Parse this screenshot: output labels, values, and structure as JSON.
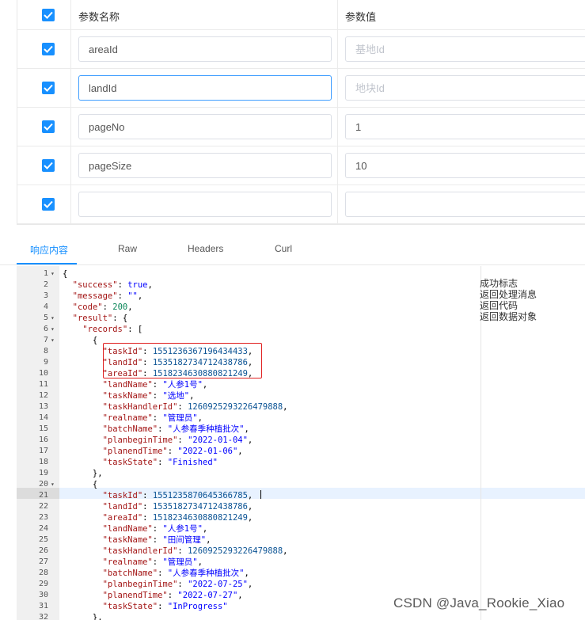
{
  "params": {
    "header": {
      "name": "参数名称",
      "value": "参数值"
    },
    "rows": [
      {
        "checked": true,
        "name": "areaId",
        "value": "",
        "placeholder": "基地Id"
      },
      {
        "checked": true,
        "name": "landId",
        "value": "",
        "placeholder": "地块Id"
      },
      {
        "checked": true,
        "name": "pageNo",
        "value": "1",
        "placeholder": ""
      },
      {
        "checked": true,
        "name": "pageSize",
        "value": "10",
        "placeholder": ""
      },
      {
        "checked": true,
        "name": "",
        "value": "",
        "placeholder": ""
      }
    ]
  },
  "tabs": [
    "响应内容",
    "Raw",
    "Headers",
    "Curl"
  ],
  "active_tab": "响应内容",
  "comments": [
    "成功标志",
    "返回处理消息",
    "返回代码",
    "返回数据对象"
  ],
  "code_lines": [
    {
      "n": "1",
      "fold": true,
      "code": "{"
    },
    {
      "n": "2",
      "code": "  \"success\": true,"
    },
    {
      "n": "3",
      "code": "  \"message\": \"\","
    },
    {
      "n": "4",
      "code": "  \"code\": 200,"
    },
    {
      "n": "5",
      "fold": true,
      "code": "  \"result\": {"
    },
    {
      "n": "6",
      "fold": true,
      "code": "    \"records\": ["
    },
    {
      "n": "7",
      "fold": true,
      "code": "      {"
    },
    {
      "n": "8",
      "code": "        \"taskId\": 1551236367196434433,"
    },
    {
      "n": "9",
      "code": "        \"landId\": 1535182734712438786,"
    },
    {
      "n": "10",
      "code": "        \"areaId\": 1518234630880821249,"
    },
    {
      "n": "11",
      "code": "        \"landName\": \"人参1号\","
    },
    {
      "n": "12",
      "code": "        \"taskName\": \"选地\","
    },
    {
      "n": "13",
      "code": "        \"taskHandlerId\": 1260925293226479888,"
    },
    {
      "n": "14",
      "code": "        \"realname\": \"管理员\","
    },
    {
      "n": "15",
      "code": "        \"batchName\": \"人参春季种植批次\","
    },
    {
      "n": "16",
      "code": "        \"planbeginTime\": \"2022-01-04\","
    },
    {
      "n": "17",
      "code": "        \"planendTime\": \"2022-01-06\","
    },
    {
      "n": "18",
      "code": "        \"taskState\": \"Finished\""
    },
    {
      "n": "19",
      "code": "      },"
    },
    {
      "n": "20",
      "fold": true,
      "code": "      {"
    },
    {
      "n": "21",
      "code": "        \"taskId\": 1551235870645366785,"
    },
    {
      "n": "22",
      "code": "        \"landId\": 1535182734712438786,"
    },
    {
      "n": "23",
      "code": "        \"areaId\": 1518234630880821249,"
    },
    {
      "n": "24",
      "code": "        \"landName\": \"人参1号\","
    },
    {
      "n": "25",
      "code": "        \"taskName\": \"田间管理\","
    },
    {
      "n": "26",
      "code": "        \"taskHandlerId\": 1260925293226479888,"
    },
    {
      "n": "27",
      "code": "        \"realname\": \"管理员\","
    },
    {
      "n": "28",
      "code": "        \"batchName\": \"人参春季种植批次\","
    },
    {
      "n": "29",
      "code": "        \"planbeginTime\": \"2022-07-25\","
    },
    {
      "n": "30",
      "code": "        \"planendTime\": \"2022-07-27\","
    },
    {
      "n": "31",
      "code": "        \"taskState\": \"InProgress\""
    },
    {
      "n": "32",
      "code": "      },"
    }
  ],
  "watermark": "CSDN @Java_Rookie_Xiao"
}
